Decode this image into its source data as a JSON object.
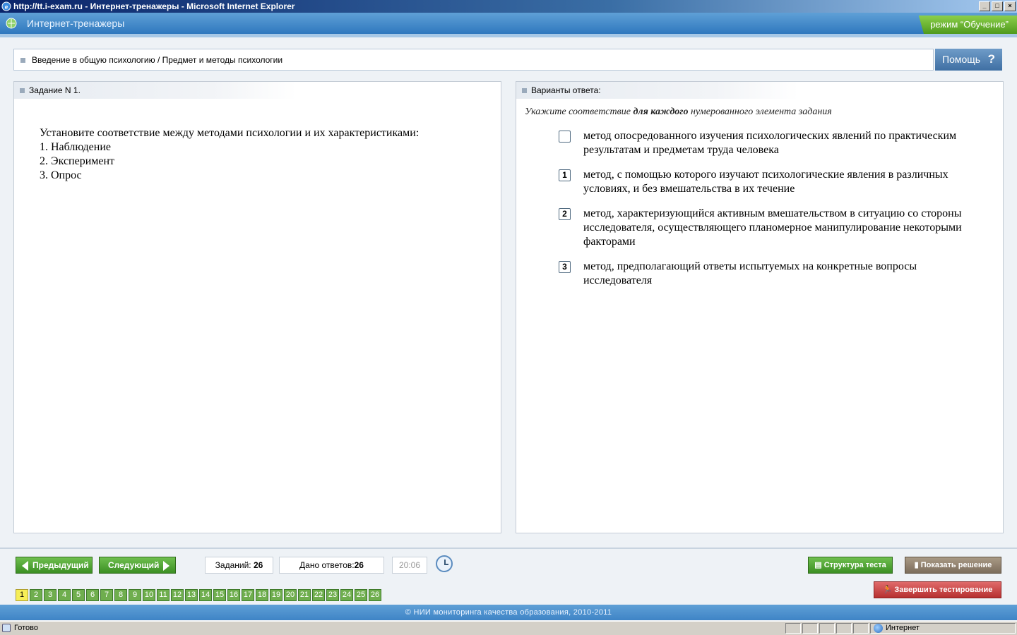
{
  "window": {
    "title": "http://tt.i-exam.ru - Интернет-тренажеры - Microsoft Internet Explorer",
    "buttons": [
      "_",
      "□",
      "×"
    ]
  },
  "header": {
    "app_title": "Интернет-тренажеры",
    "mode_label": "режим “Обучение”"
  },
  "breadcrumb": {
    "text": "Введение в общую психологию / Предмет и методы психологии"
  },
  "help": {
    "label": "Помощь",
    "icon_text": "?"
  },
  "task": {
    "header": "Задание N 1.",
    "lines": [
      "Установите соответствие между методами психологии и их характеристиками:",
      "1. Наблюдение",
      "2. Эксперимент",
      "3. Опрос"
    ]
  },
  "answers": {
    "header": "Варианты ответа:",
    "instruction_before": "Укажите соответствие ",
    "instruction_bold": "для каждого",
    "instruction_after": " нумерованного элемента задания",
    "items": [
      {
        "mark": "",
        "text": "метод опосредованного изучения психологических явлений по практическим результатам и предметам труда человека"
      },
      {
        "mark": "1",
        "text": "метод, с помощью которого изучают психологические явления в различных условиях, и без вмешательства в их течение"
      },
      {
        "mark": "2",
        "text": "метод, характеризующийся активным вмешательством в ситуацию со стороны исследователя, осуществляющего планомерное манипулирование некоторыми факторами"
      },
      {
        "mark": "3",
        "text": "метод, предполагающий ответы испытуемых на конкретные вопросы исследователя"
      }
    ]
  },
  "nav": {
    "prev_label": "Предыдущий",
    "next_label": "Следующий",
    "tasks_label": "Заданий:",
    "tasks_value": "26",
    "answered_label": "Дано ответов:",
    "answered_value": "26",
    "timer": "20:06",
    "structure_label": "Структура теста",
    "show_solution_label": "Показать решение",
    "finish_label": "Завершить тестирование",
    "pages": [
      "1",
      "2",
      "3",
      "4",
      "5",
      "6",
      "7",
      "8",
      "9",
      "10",
      "11",
      "12",
      "13",
      "14",
      "15",
      "16",
      "17",
      "18",
      "19",
      "20",
      "21",
      "22",
      "23",
      "24",
      "25",
      "26"
    ],
    "current_page": "1"
  },
  "footer": {
    "text": "© НИИ мониторинга качества образования, 2010-2011"
  },
  "statusbar": {
    "status": "Готово",
    "zone": "Интернет"
  }
}
